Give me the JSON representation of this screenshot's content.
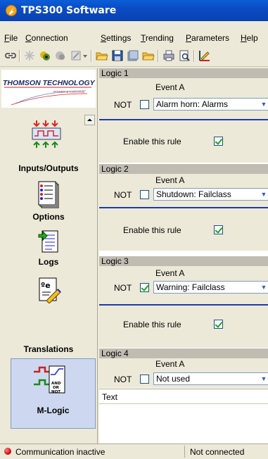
{
  "window": {
    "title": "TPS300 Software"
  },
  "menu": [
    "File",
    "Connection",
    "Settings",
    "Trending",
    "Parameters",
    "Help"
  ],
  "menu_underline": [
    "F",
    "C",
    "S",
    "T",
    "P",
    "H"
  ],
  "toolbar_icons": [
    "connect-icon",
    "disconnect-icon",
    "read-icon",
    "write-icon",
    "edit-icon",
    "dropdown-icon",
    "open-icon",
    "save-icon",
    "save-all-icon",
    "open-folder-icon",
    "print-icon",
    "print-preview-icon",
    "edit-pen-icon"
  ],
  "logo": {
    "company": "THOMSON TECHNOLOGY",
    "tagline": "POWER & CONTROL"
  },
  "sidebar": [
    {
      "label": "Inputs/Outputs",
      "icon": "inputs-outputs-icon",
      "active": false
    },
    {
      "label": "Options",
      "icon": "options-icon",
      "active": false
    },
    {
      "label": "Logs",
      "icon": "logs-icon",
      "active": false
    },
    {
      "label": "Translations",
      "icon": "translations-icon",
      "active": false
    },
    {
      "label": "M-Logic",
      "icon": "m-logic-icon",
      "active": true
    }
  ],
  "logic": [
    {
      "title": "Logic 1",
      "event_label": "Event A",
      "not_label": "NOT",
      "not_checked": false,
      "event_value": "Alarm horn: Alarms",
      "enable_label": "Enable this rule",
      "enabled": true
    },
    {
      "title": "Logic 2",
      "event_label": "Event A",
      "not_label": "NOT",
      "not_checked": false,
      "event_value": "Shutdown: Failclass",
      "enable_label": "Enable this rule",
      "enabled": true
    },
    {
      "title": "Logic 3",
      "event_label": "Event A",
      "not_label": "NOT",
      "not_checked": true,
      "event_value": "Warning: Failclass",
      "enable_label": "Enable this rule",
      "enabled": true
    },
    {
      "title": "Logic 4",
      "event_label": "Event A",
      "not_label": "NOT",
      "not_checked": false,
      "event_value": "Not used"
    }
  ],
  "text_panel": {
    "label": "Text"
  },
  "status": {
    "communication": "Communication inactive",
    "connection": "Not connected"
  },
  "colors": {
    "title_bar": "#0a4bc4",
    "rule_divider": "#1c3aa8",
    "check_green": "#21a121",
    "status_red": "#c40000"
  }
}
